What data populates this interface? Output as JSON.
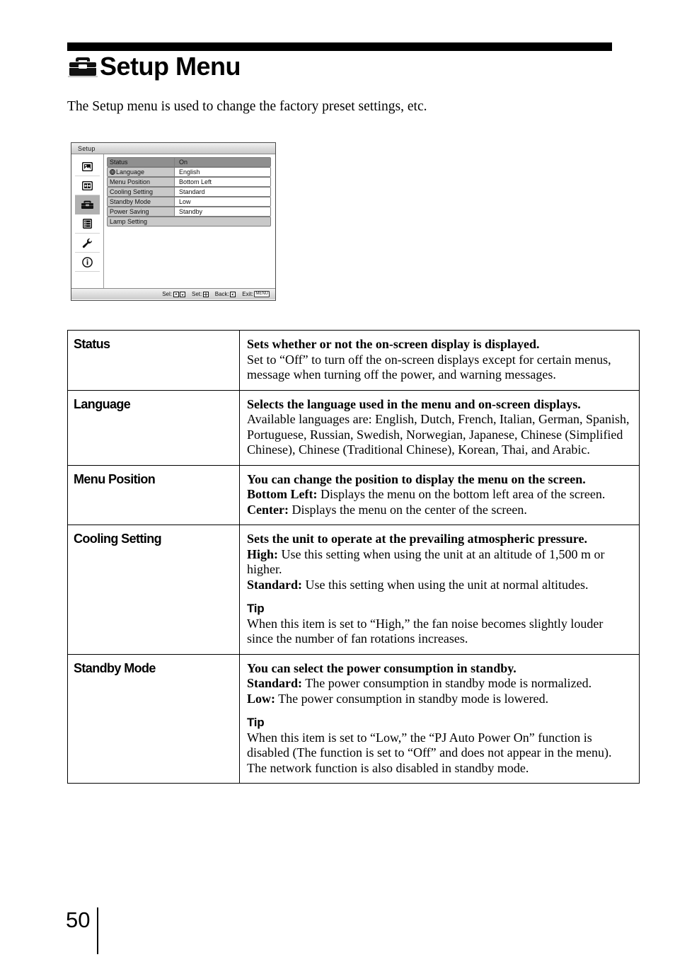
{
  "page": {
    "title": "Setup Menu",
    "title_icon": "toolbox-icon",
    "intro": "The Setup menu is used to change the factory preset settings, etc.",
    "page_number": "50"
  },
  "osd": {
    "window_title": "Setup",
    "sidebar_icons": [
      {
        "name": "picture-icon",
        "selected": false
      },
      {
        "name": "screen-grid-icon",
        "selected": false
      },
      {
        "name": "toolbox-icon",
        "selected": true
      },
      {
        "name": "function-list-icon",
        "selected": false
      },
      {
        "name": "wrench-icon",
        "selected": false
      },
      {
        "name": "information-icon",
        "selected": false
      }
    ],
    "rows": [
      {
        "label": "Status",
        "value": "On",
        "selected": true,
        "icon": null
      },
      {
        "label": "Language",
        "value": "English",
        "selected": false,
        "icon": "globe-icon"
      },
      {
        "label": "Menu Position",
        "value": "Bottom Left",
        "selected": false,
        "icon": null
      },
      {
        "label": "Cooling Setting",
        "value": "Standard",
        "selected": false,
        "icon": null
      },
      {
        "label": "Standby Mode",
        "value": "Low",
        "selected": false,
        "icon": null
      },
      {
        "label": "Power Saving",
        "value": "Standby",
        "selected": false,
        "icon": null
      },
      {
        "label": "Lamp Setting",
        "value": "",
        "selected": false,
        "icon": null
      }
    ],
    "footer": {
      "sel_label": "Sel:",
      "set_label": "Set:",
      "back_label": "Back:",
      "exit_label": "Exit:",
      "exit_key": "MENU"
    }
  },
  "table": {
    "rows": [
      {
        "name": "Status",
        "heading": "Sets whether or not the on-screen display is displayed.",
        "lines": [
          {
            "text": "Set to “Off” to turn off the on-screen displays except for certain menus, message when turning off the power, and warning messages."
          }
        ],
        "tip": null
      },
      {
        "name": "Language",
        "heading": "Selects the language used in the menu and on-screen displays.",
        "lines": [
          {
            "text": "Available languages are: English, Dutch, French, Italian, German, Spanish, Portuguese, Russian, Swedish, Norwegian, Japanese, Chinese (Simplified Chinese), Chinese (Traditional Chinese), Korean, Thai, and Arabic."
          }
        ],
        "tip": null
      },
      {
        "name": "Menu Position",
        "heading": "You can change the position to display the menu on the screen.",
        "lines": [
          {
            "term": "Bottom Left:",
            "text": " Displays the menu on the bottom left area of the screen."
          },
          {
            "term": "Center:",
            "text": " Displays the menu on the center of the screen."
          }
        ],
        "tip": null
      },
      {
        "name": "Cooling Setting",
        "heading": "Sets the unit to operate at the prevailing atmospheric pressure.",
        "lines": [
          {
            "term": "High:",
            "text": " Use this setting when using the unit at an altitude of 1,500 m or higher."
          },
          {
            "term": "Standard:",
            "text": " Use this setting when using the unit at normal altitudes."
          }
        ],
        "tip": {
          "title": "Tip",
          "text": "When this item is set to “High,” the fan noise becomes slightly louder since the number of fan rotations increases."
        }
      },
      {
        "name": "Standby Mode",
        "heading": "You can select the power consumption in standby.",
        "lines": [
          {
            "term": "Standard:",
            "text": " The power consumption in standby mode is normalized."
          },
          {
            "term": "Low:",
            "text": " The power consumption in standby mode is lowered."
          }
        ],
        "tip": {
          "title": "Tip",
          "text": "When this item is set to “Low,” the “PJ Auto Power On” function is disabled (The function is set to “Off” and does not appear in the menu). The network function is also disabled in standby mode."
        }
      }
    ]
  }
}
